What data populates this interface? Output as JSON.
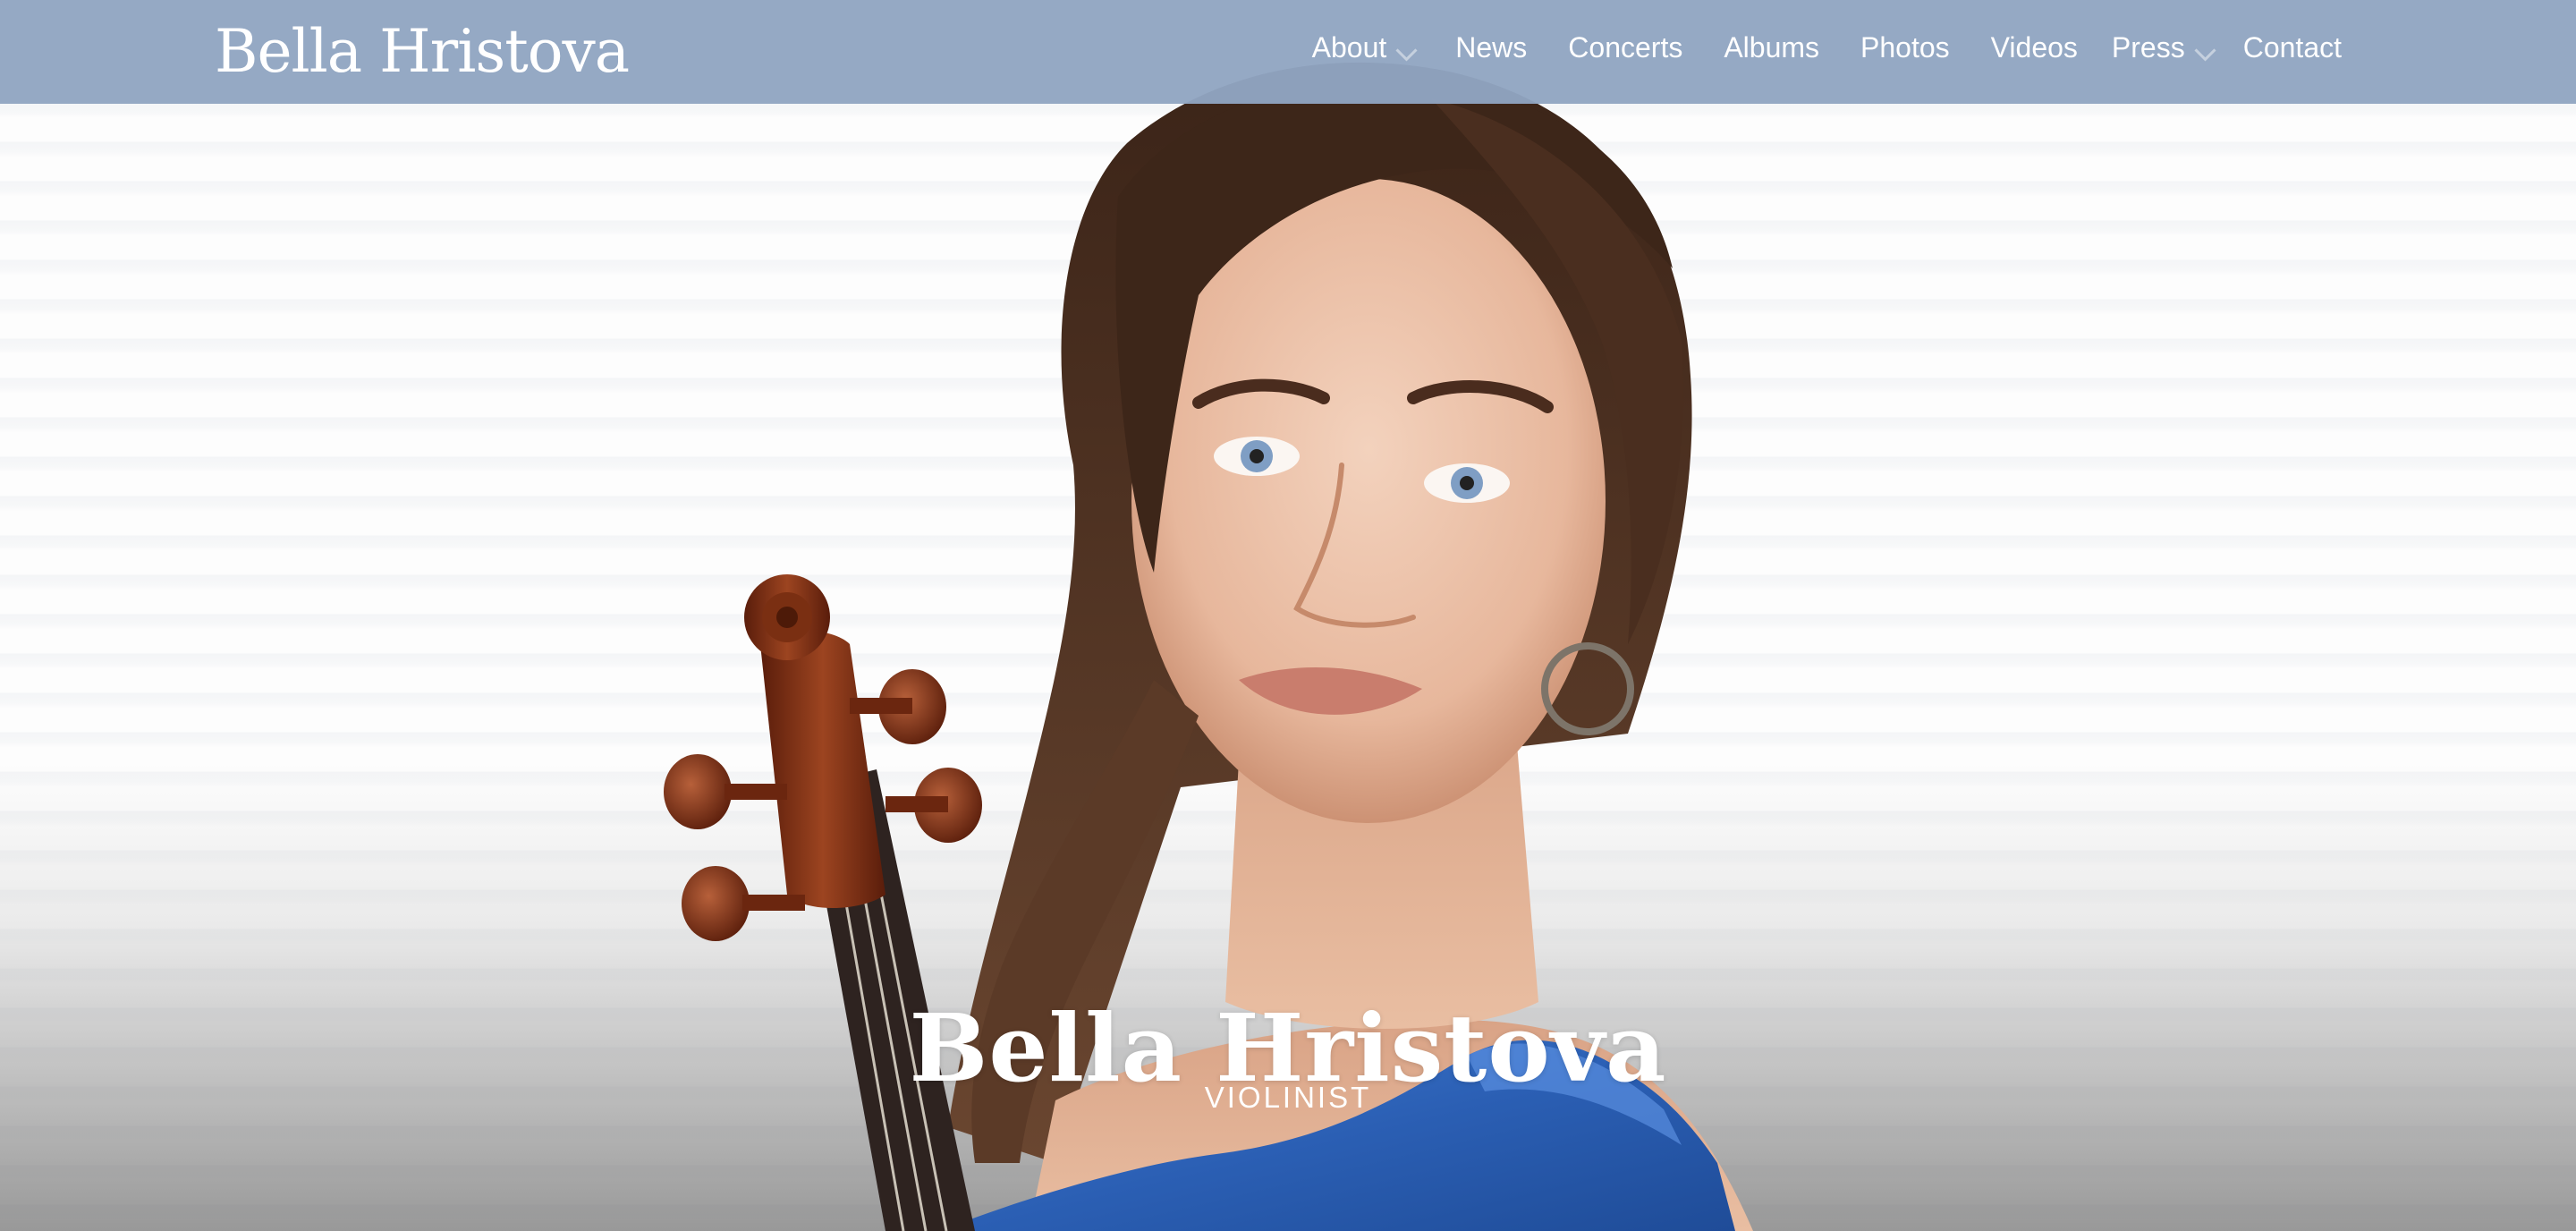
{
  "site": {
    "logo_text": "Bella Hristova"
  },
  "nav": {
    "items": [
      {
        "label": "About",
        "has_dropdown": true
      },
      {
        "label": "News",
        "has_dropdown": false
      },
      {
        "label": "Concerts",
        "has_dropdown": false
      },
      {
        "label": "Albums",
        "has_dropdown": false
      },
      {
        "label": "Photos",
        "has_dropdown": false
      },
      {
        "label": "Videos",
        "has_dropdown": false
      },
      {
        "label": "Press",
        "has_dropdown": true
      },
      {
        "label": "Contact",
        "has_dropdown": false
      }
    ]
  },
  "hero": {
    "title": "Bella Hristova",
    "subtitle": "VIOLINIST"
  },
  "colors": {
    "navbar": "#91a6c2",
    "nav_text": "#ffffff",
    "dress": "#2f64b8",
    "hair": "#4a3122",
    "violin": "#7a2e12"
  }
}
